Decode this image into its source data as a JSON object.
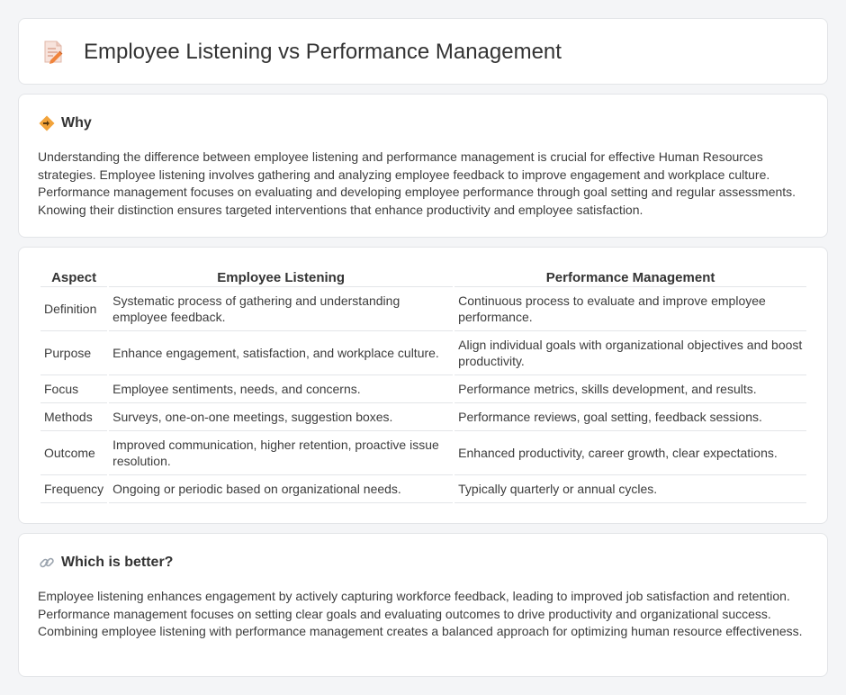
{
  "header": {
    "title": "Employee Listening vs Performance Management",
    "icon": "document-pencil-icon"
  },
  "why": {
    "title": "Why",
    "icon": "diamond-signpost-icon",
    "body": "Understanding the difference between employee listening and performance management is crucial for effective Human Resources strategies. Employee listening involves gathering and analyzing employee feedback to improve engagement and workplace culture. Performance management focuses on evaluating and developing employee performance through goal setting and regular assessments. Knowing their distinction ensures targeted interventions that enhance productivity and employee satisfaction."
  },
  "table": {
    "headers": [
      "Aspect",
      "Employee Listening",
      "Performance Management"
    ],
    "rows": [
      [
        "Definition",
        "Systematic process of gathering and understanding employee feedback.",
        "Continuous process to evaluate and improve employee performance."
      ],
      [
        "Purpose",
        "Enhance engagement, satisfaction, and workplace culture.",
        "Align individual goals with organizational objectives and boost productivity."
      ],
      [
        "Focus",
        "Employee sentiments, needs, and concerns.",
        "Performance metrics, skills development, and results."
      ],
      [
        "Methods",
        "Surveys, one-on-one meetings, suggestion boxes.",
        "Performance reviews, goal setting, feedback sessions."
      ],
      [
        "Outcome",
        "Improved communication, higher retention, proactive issue resolution.",
        "Enhanced productivity, career growth, clear expectations."
      ],
      [
        "Frequency",
        "Ongoing or periodic based on organizational needs.",
        "Typically quarterly or annual cycles."
      ]
    ]
  },
  "better": {
    "title": "Which is better?",
    "icon": "link-icon",
    "body": "Employee listening enhances engagement by actively capturing workforce feedback, leading to improved job satisfaction and retention. Performance management focuses on setting clear goals and evaluating outcomes to drive productivity and organizational success. Combining employee listening with performance management creates a balanced approach for optimizing human resource effectiveness."
  },
  "colors": {
    "accent": "#f2a33a",
    "page_bg": "#f4f5f7",
    "card_border": "#e3e5e8"
  }
}
